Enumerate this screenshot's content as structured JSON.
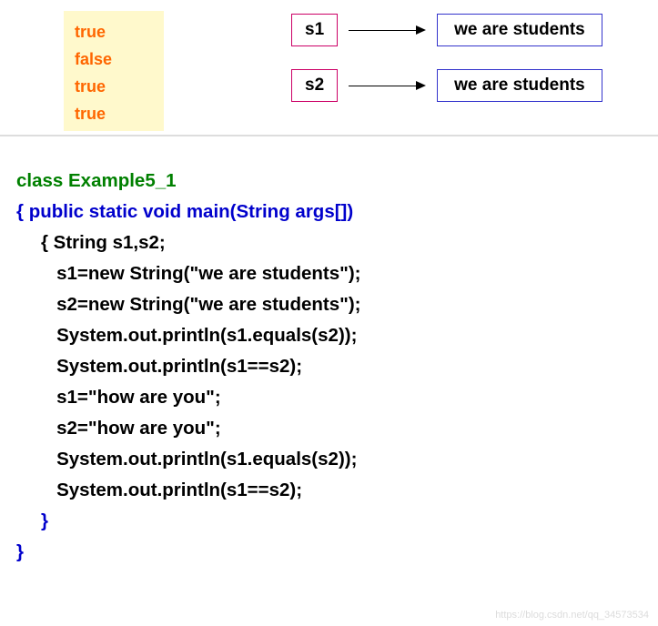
{
  "output": [
    "true",
    "false",
    "true",
    "true"
  ],
  "diagram": {
    "rows": [
      {
        "var": "s1",
        "value": "we are students"
      },
      {
        "var": "s2",
        "value": "we are students"
      }
    ]
  },
  "code": {
    "line1_class": "class ",
    "line1_name": "Example5_1",
    "line2_brace": "{  ",
    "line2_sig": "public static void main(String args[])",
    "line3": "{ String s1,s2;",
    "line4": "   s1=new String(\"we are students\");",
    "line5": "   s2=new String(\"we are students\");",
    "line6": "   System.out.println(s1.equals(s2));",
    "line7": "   System.out.println(s1==s2);",
    "line8": "   s1=\"how are you\";",
    "line9": "   s2=\"how are you\";",
    "line10": "   System.out.println(s1.equals(s2));",
    "line11": "   System.out.println(s1==s2);",
    "line12": "}",
    "line13": "}"
  },
  "watermark": "https://blog.csdn.net/qq_34573534"
}
